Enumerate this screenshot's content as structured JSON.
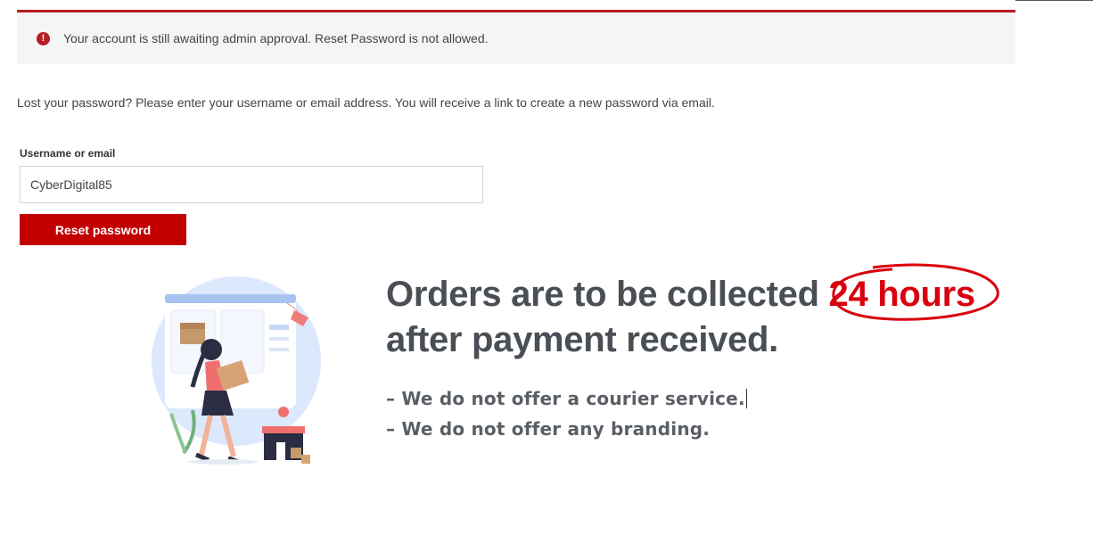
{
  "notice": {
    "icon": "exclamation-circle-icon",
    "icon_glyph": "!",
    "text": "Your account is still awaiting admin approval. Reset Password is not allowed.",
    "accent_color": "#b81c23"
  },
  "intro": {
    "text": "Lost your password? Please enter your username or email address. You will receive a link to create a new password via email."
  },
  "form": {
    "username_label": "Username or email",
    "username_value": "CyberDigital85",
    "submit_label": "Reset password",
    "button_color": "#c30000"
  },
  "promo": {
    "headline_part1": "Orders are to be collected ",
    "headline_highlight": "24 hours",
    "headline_part2": "after payment received.",
    "bullets": [
      "– We do not offer a courier service.",
      "– We do not offer any branding."
    ],
    "highlight_color": "#d9000d",
    "illustration": "delivery-woman-with-boxes-illustration"
  }
}
